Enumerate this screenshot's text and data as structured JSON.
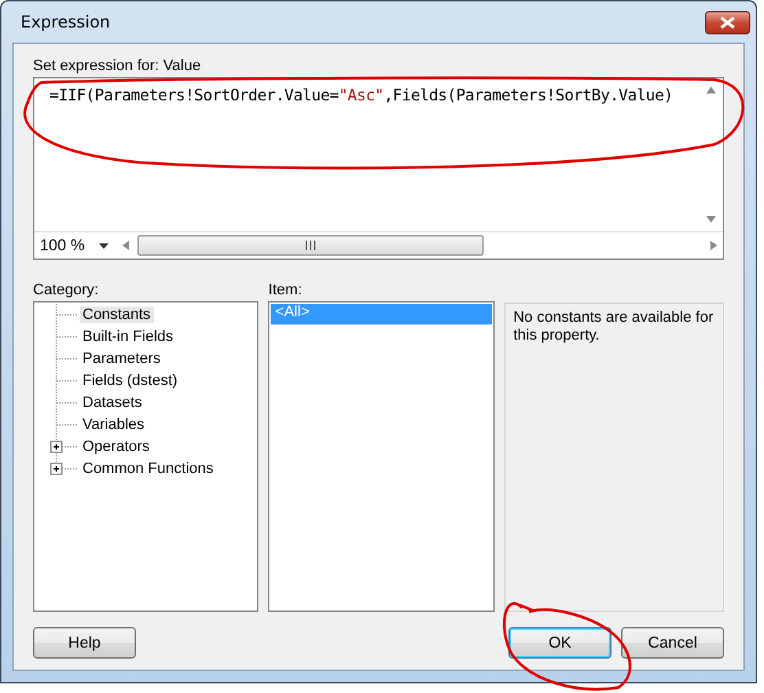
{
  "window": {
    "title": "Expression"
  },
  "expression": {
    "label": "Set expression for: Value",
    "parts": [
      {
        "text": "=IIF(Parameters!SortOrder.Value=",
        "kind": "code"
      },
      {
        "text": "\"Asc\"",
        "kind": "string"
      },
      {
        "text": ",Fields(Parameters!SortBy.Value)",
        "kind": "code"
      }
    ],
    "zoom": "100 %"
  },
  "category": {
    "label": "Category:",
    "items": [
      {
        "label": "Constants",
        "kind": "leaf",
        "selected": true
      },
      {
        "label": "Built-in Fields",
        "kind": "leaf",
        "selected": false
      },
      {
        "label": "Parameters",
        "kind": "leaf",
        "selected": false
      },
      {
        "label": "Fields (dstest)",
        "kind": "leaf",
        "selected": false
      },
      {
        "label": "Datasets",
        "kind": "leaf",
        "selected": false
      },
      {
        "label": "Variables",
        "kind": "leaf",
        "selected": false
      },
      {
        "label": "Operators",
        "kind": "group",
        "selected": false
      },
      {
        "label": "Common Functions",
        "kind": "group",
        "selected": false
      }
    ]
  },
  "item": {
    "label": "Item:",
    "items": [
      {
        "label": "<All>",
        "selected": true
      }
    ]
  },
  "description": "No constants are available for this property.",
  "buttons": [
    {
      "label": "Help",
      "kind": "left",
      "default": false
    },
    {
      "label": "OK",
      "kind": "right",
      "default": true
    },
    {
      "label": "Cancel",
      "kind": "right",
      "default": false
    }
  ]
}
